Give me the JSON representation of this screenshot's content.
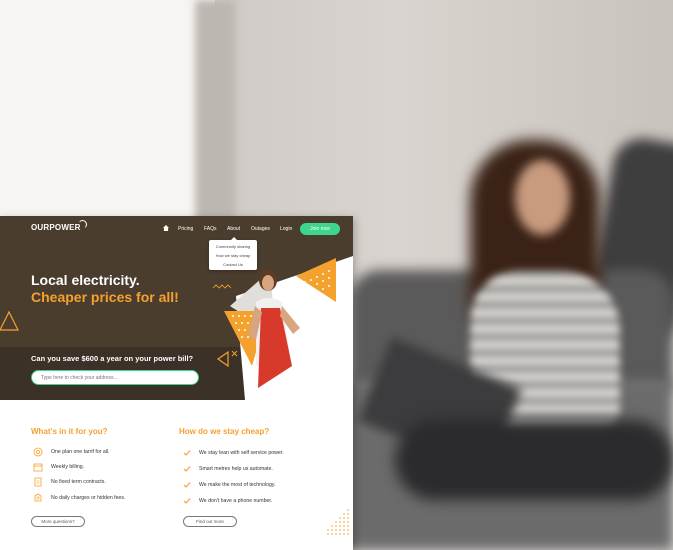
{
  "nav": {
    "logo": "OURPOWER",
    "links": [
      "Pricing",
      "FAQs",
      "About",
      "Outages",
      "Login"
    ],
    "join_label": "Join now"
  },
  "about_dropdown": {
    "items": [
      "Community sharing",
      "How we stay cheap",
      "Contact Us"
    ]
  },
  "hero": {
    "headline_1": "Local electricity.",
    "headline_2": "Cheaper prices for all!",
    "question": "Can you save $600 a year on your power bill?",
    "address_placeholder": "Type here to check your address..."
  },
  "whats_in_it": {
    "title": "What's in it for you?",
    "items": [
      {
        "label": "One plan one tarrif for all.",
        "icon": "plan-icon"
      },
      {
        "label": "Weekly billing.",
        "icon": "calendar-icon"
      },
      {
        "label": "No fixed term contracts.",
        "icon": "contract-icon"
      },
      {
        "label": "No daily charges or hidden fees.",
        "icon": "fees-icon"
      }
    ],
    "button_label": "More questions?"
  },
  "stay_cheap": {
    "title": "How do we stay cheap?",
    "items": [
      "We stay lean with self service power.",
      "Smart metres help us automate.",
      "We make the most of technology.",
      "We don't have a phone number."
    ],
    "button_label": "Find out more"
  },
  "colors": {
    "accent_orange": "#f5a12d",
    "accent_green": "#3dd68c",
    "hero_brown": "#4a3d2e"
  }
}
